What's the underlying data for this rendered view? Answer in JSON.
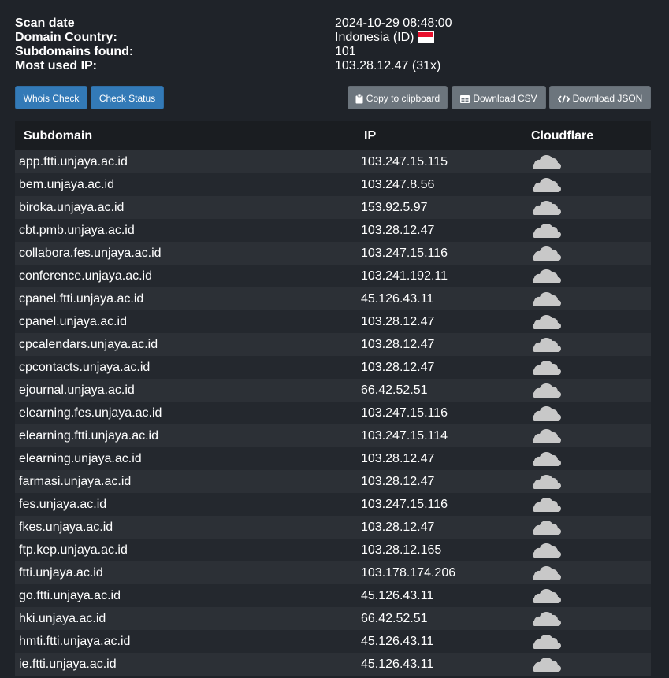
{
  "info": {
    "scan_date_label": "Scan date",
    "scan_date_value": "2024-10-29 08:48:00",
    "country_label": "Domain Country:",
    "country_value": "Indonesia (ID)",
    "subdomains_label": "Subdomains found:",
    "subdomains_value": "101",
    "most_ip_label": "Most used IP:",
    "most_ip_value": "103.28.12.47 (31x)"
  },
  "toolbar": {
    "whois_label": "Whois Check",
    "status_label": "Check Status",
    "copy_label": "Copy to clipboard",
    "csv_label": "Download CSV",
    "json_label": "Download JSON"
  },
  "table": {
    "headers": {
      "subdomain": "Subdomain",
      "ip": "IP",
      "cloudflare": "Cloudflare"
    },
    "rows": [
      {
        "subdomain": "app.ftti.unjaya.ac.id",
        "ip": "103.247.15.115"
      },
      {
        "subdomain": "bem.unjaya.ac.id",
        "ip": "103.247.8.56"
      },
      {
        "subdomain": "biroka.unjaya.ac.id",
        "ip": "153.92.5.97"
      },
      {
        "subdomain": "cbt.pmb.unjaya.ac.id",
        "ip": "103.28.12.47"
      },
      {
        "subdomain": "collabora.fes.unjaya.ac.id",
        "ip": "103.247.15.116"
      },
      {
        "subdomain": "conference.unjaya.ac.id",
        "ip": "103.241.192.11"
      },
      {
        "subdomain": "cpanel.ftti.unjaya.ac.id",
        "ip": "45.126.43.11"
      },
      {
        "subdomain": "cpanel.unjaya.ac.id",
        "ip": "103.28.12.47"
      },
      {
        "subdomain": "cpcalendars.unjaya.ac.id",
        "ip": "103.28.12.47"
      },
      {
        "subdomain": "cpcontacts.unjaya.ac.id",
        "ip": "103.28.12.47"
      },
      {
        "subdomain": "ejournal.unjaya.ac.id",
        "ip": "66.42.52.51"
      },
      {
        "subdomain": "elearning.fes.unjaya.ac.id",
        "ip": "103.247.15.116"
      },
      {
        "subdomain": "elearning.ftti.unjaya.ac.id",
        "ip": "103.247.15.114"
      },
      {
        "subdomain": "elearning.unjaya.ac.id",
        "ip": "103.28.12.47"
      },
      {
        "subdomain": "farmasi.unjaya.ac.id",
        "ip": "103.28.12.47"
      },
      {
        "subdomain": "fes.unjaya.ac.id",
        "ip": "103.247.15.116"
      },
      {
        "subdomain": "fkes.unjaya.ac.id",
        "ip": "103.28.12.47"
      },
      {
        "subdomain": "ftp.kep.unjaya.ac.id",
        "ip": "103.28.12.165"
      },
      {
        "subdomain": "ftti.unjaya.ac.id",
        "ip": "103.178.174.206"
      },
      {
        "subdomain": "go.ftti.unjaya.ac.id",
        "ip": "45.126.43.11"
      },
      {
        "subdomain": "hki.unjaya.ac.id",
        "ip": "66.42.52.51"
      },
      {
        "subdomain": "hmti.ftti.unjaya.ac.id",
        "ip": "45.126.43.11"
      },
      {
        "subdomain": "ie.ftti.unjaya.ac.id",
        "ip": "45.126.43.11"
      }
    ]
  },
  "colors": {
    "background": "#1f2329",
    "primary_button": "#337ab7",
    "secondary_button": "#6c757d",
    "cloud_icon": "#c8c8c8"
  },
  "icons": {
    "flag": "indonesia-flag-icon",
    "copy": "clipboard-icon",
    "csv": "table-icon",
    "json": "code-icon",
    "cloudflare": "cloud-icon"
  }
}
